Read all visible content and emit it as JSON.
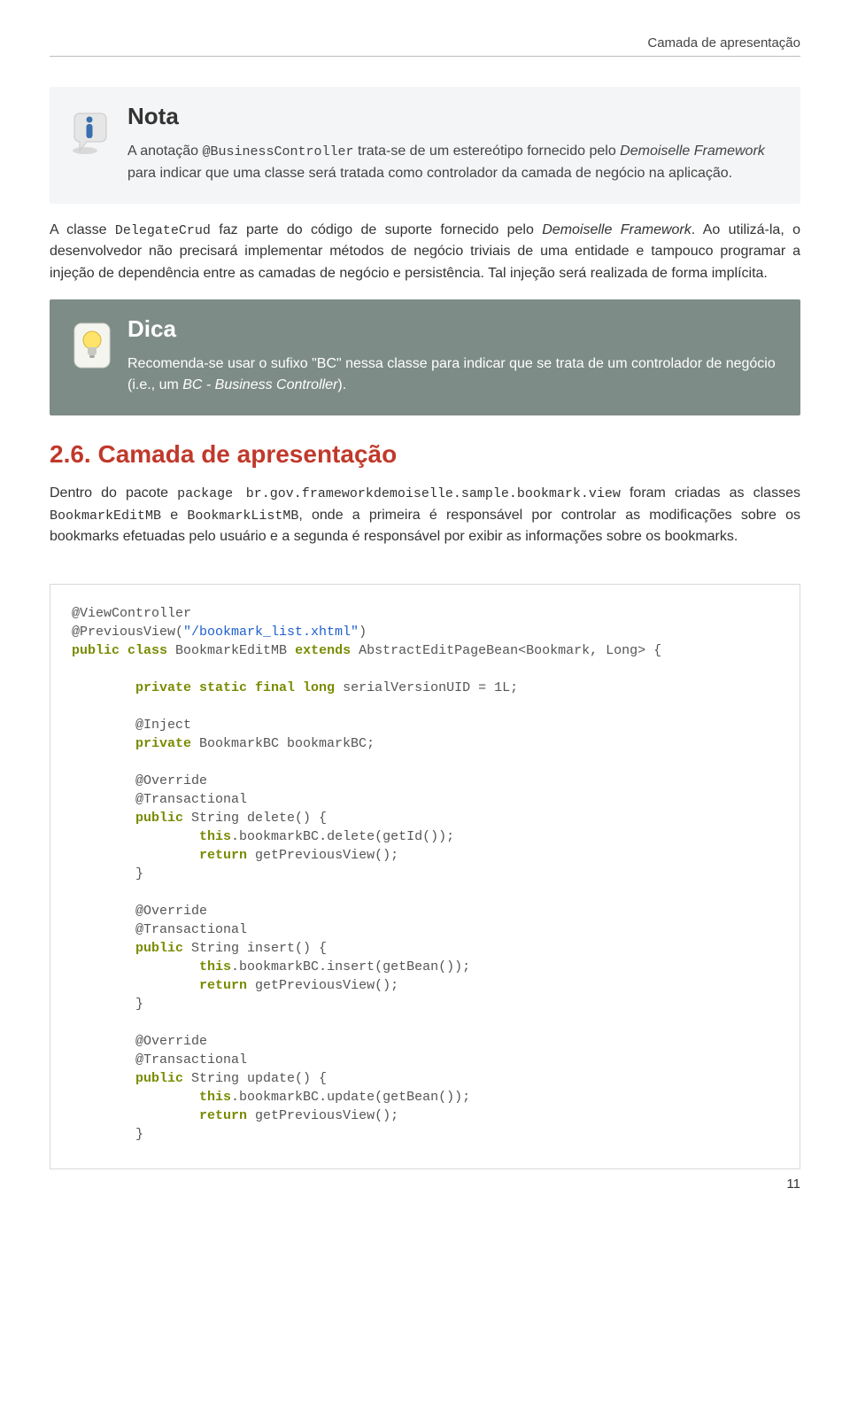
{
  "header": {
    "running": "Camada de apresentação"
  },
  "note": {
    "title": "Nota",
    "p1a": "A anotação ",
    "p1_code": "@BusinessController",
    "p1b": " trata-se de um estereótipo fornecido pelo ",
    "p1_it": "Demoiselle Framework",
    "p1c": " para indicar que uma classe será tratada como controlador da camada de negócio na aplicação."
  },
  "body": {
    "p1a": "A classe ",
    "p1_code": "DelegateCrud",
    "p1b": " faz parte do código de suporte fornecido pelo ",
    "p1_it": "Demoiselle Framework",
    "p1c": ". Ao utilizá-la, o desenvolvedor não precisará implementar métodos de negócio triviais de uma entidade e tampouco programar a injeção de dependência entre as camadas de negócio e persistência. Tal injeção será realizada de forma implícita."
  },
  "tip": {
    "title": "Dica",
    "p1a": "Recomenda-se usar o sufixo \"BC\" nessa classe para indicar que se trata de um controlador de negócio (i.e., um ",
    "p1_it": "BC - Business Controller",
    "p1b": ")."
  },
  "section": {
    "heading": "2.6. Camada de apresentação",
    "p1a": "Dentro do pacote ",
    "p1_code1": "package br.gov.frameworkdemoiselle.sample.bookmark.view",
    "p1b": " foram criadas as classes ",
    "p1_code2": "BookmarkEditMB",
    "p1c": " e ",
    "p1_code3": "BookmarkListMB",
    "p1d": ", onde a primeira é responsável por controlar as modificações sobre os bookmarks efetuadas pelo usuário e a segunda é responsável por exibir as informações sobre os bookmarks."
  },
  "code": {
    "l01": "@ViewController",
    "l02a": "@PreviousView(",
    "l02b": "\"/bookmark_list.xhtml\"",
    "l02c": ")",
    "l03a": "public class",
    "l03b": " BookmarkEditMB ",
    "l03c": "extends",
    "l03d": " AbstractEditPageBean<Bookmark, Long> {",
    "l04a": "private static final",
    "l04b": " long",
    "l04c": " serialVersionUID = 1L;",
    "l05": "@Inject",
    "l06a": "private",
    "l06b": " BookmarkBC bookmarkBC;",
    "l07": "@Override",
    "l08": "@Transactional",
    "l09a": "public",
    "l09b": " String delete() {",
    "l10a": "this",
    "l10b": ".bookmarkBC.delete(getId());",
    "l11a": "return",
    "l11b": " getPreviousView();",
    "l12": "}",
    "l13": "@Override",
    "l14": "@Transactional",
    "l15a": "public",
    "l15b": " String insert() {",
    "l16a": "this",
    "l16b": ".bookmarkBC.insert(getBean());",
    "l17a": "return",
    "l17b": " getPreviousView();",
    "l18": "}",
    "l19": "@Override",
    "l20": "@Transactional",
    "l21a": "public",
    "l21b": " String update() {",
    "l22a": "this",
    "l22b": ".bookmarkBC.update(getBean());",
    "l23a": "return",
    "l23b": " getPreviousView();",
    "l24": "}"
  },
  "footer": {
    "page": "11"
  }
}
